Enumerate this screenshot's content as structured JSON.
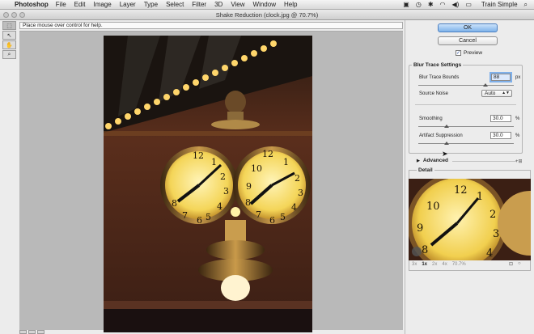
{
  "menubar": {
    "app": "Photoshop",
    "menus": [
      "File",
      "Edit",
      "Image",
      "Layer",
      "Type",
      "Select",
      "Filter",
      "3D",
      "View",
      "Window",
      "Help"
    ],
    "user": "Train Simple"
  },
  "dialog": {
    "title": "Shake Reduction (clock.jpg @ 70.7%)",
    "help_text": "Place mouse over control for help."
  },
  "buttons": {
    "ok": "OK",
    "cancel": "Cancel"
  },
  "preview": {
    "label": "Preview",
    "checked": true
  },
  "blur_trace": {
    "title": "Blur Trace Settings",
    "bounds_label": "Blur Trace Bounds",
    "bounds_value": "88",
    "bounds_unit": "px",
    "noise_label": "Source Noise",
    "noise_value": "Auto",
    "smoothing_label": "Smoothing",
    "smoothing_value": "30.0",
    "smoothing_unit": "%",
    "artifact_label": "Artifact Suppression",
    "artifact_value": "30.0",
    "artifact_unit": "%"
  },
  "advanced": {
    "label": "Advanced"
  },
  "detail": {
    "title": "Detail",
    "zoom_levels": [
      "3x",
      "1x",
      "2x",
      "4x",
      "70.7%"
    ],
    "active_zoom": "1x"
  },
  "colors": {
    "accent": "#7fb3ea",
    "panel": "#ececec",
    "canvas": "#b9b9b9"
  }
}
